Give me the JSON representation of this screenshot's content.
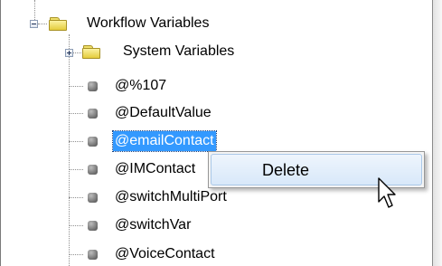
{
  "tree": {
    "root": {
      "label": "Workflow Variables",
      "expanded": true,
      "icon": "folder-open-icon"
    },
    "system_variables": {
      "label": "System Variables",
      "expanded": false,
      "icon": "folder-icon"
    },
    "variables": [
      {
        "label": "@%107"
      },
      {
        "label": "@DefaultValue"
      },
      {
        "label": "@emailContact",
        "selected": true
      },
      {
        "label": "@IMContact"
      },
      {
        "label": "@switchMultiPort"
      },
      {
        "label": "@switchVar"
      },
      {
        "label": "@VoiceContact"
      }
    ]
  },
  "context_menu": {
    "items": [
      {
        "label": "Delete",
        "hovered": true
      }
    ]
  },
  "colors": {
    "selection": "#3399ff",
    "folder": "#efdf6a",
    "menu_hover": "#d8e8f9"
  }
}
